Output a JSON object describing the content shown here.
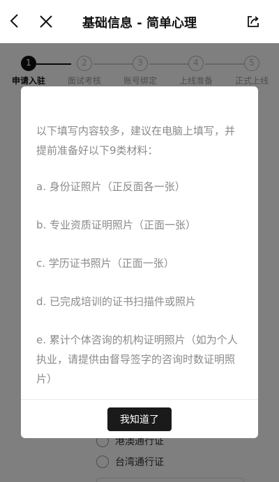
{
  "header": {
    "title": "基础信息 - 简单心理"
  },
  "steps": [
    {
      "number": "1",
      "label": "申请入驻"
    },
    {
      "number": "2",
      "label": "面试考核"
    },
    {
      "number": "3",
      "label": "账号绑定"
    },
    {
      "number": "4",
      "label": "上线准备"
    },
    {
      "number": "5",
      "label": "正式上线"
    }
  ],
  "form": {
    "id_options": [
      "港澳通行证",
      "台湾通行证"
    ]
  },
  "modal": {
    "intro": "以下填写内容较多，建议在电脑上填写，并提前准备好以下9类材料：",
    "items": [
      "a. 身份证照片（正反面各一张）",
      "b. 专业资质证明照片（正面一张）",
      "c. 学历证书照片（正面一张）",
      "d. 已完成培训的证书扫描件或照片",
      "e. 累计个体咨询的机构证明照片（如为个人执业，请提供由督导签字的咨询时数证明照片）"
    ],
    "confirm_label": "我知道了"
  }
}
